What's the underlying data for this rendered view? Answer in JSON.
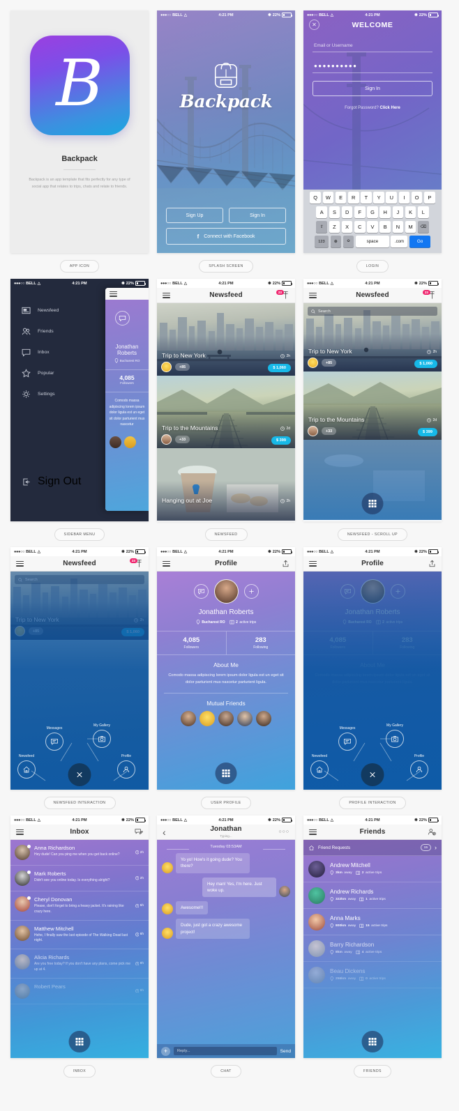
{
  "status_bar": {
    "carrier": "BELL",
    "time": "4:21 PM",
    "battery": "22%",
    "dots": "●●●○○"
  },
  "screens": [
    {
      "caption": "APP ICON"
    },
    {
      "caption": "SPLASH SCREEN"
    },
    {
      "caption": "LOGIN"
    },
    {
      "caption": "SIDEBAR MENU"
    },
    {
      "caption": "NEWSFEED"
    },
    {
      "caption": "NEWSFEED - SCROLL UP"
    },
    {
      "caption": "NEWSFEED INTERACTION"
    },
    {
      "caption": "USER PROFILE"
    },
    {
      "caption": "PROFILE INTERACTION"
    },
    {
      "caption": "INBOX"
    },
    {
      "caption": "CHAT"
    },
    {
      "caption": "FRIENDS"
    }
  ],
  "app_icon": {
    "logo_letter": "Β",
    "name": "Backpack",
    "description": "Backpack is an app template that fits perfectly for any type of social app that relates to trips, chats and relate to friends."
  },
  "splash": {
    "logo_text": "Backpack",
    "sign_up": "Sign Up",
    "sign_in": "Sign In",
    "facebook": "Connect with Facebook",
    "facebook_glyph": "f"
  },
  "login": {
    "title": "WELCOME",
    "close_glyph": "✕",
    "email_placeholder": "Email or Username",
    "password_value": "●●●●●●●●●●",
    "sign_in": "Sign In",
    "forgot_label": "Forgot Password? ",
    "forgot_link": "Click Here",
    "keyboard": {
      "row1": [
        "Q",
        "W",
        "E",
        "R",
        "T",
        "Y",
        "U",
        "I",
        "O",
        "P"
      ],
      "row2": [
        "A",
        "S",
        "D",
        "F",
        "G",
        "H",
        "J",
        "K",
        "L"
      ],
      "row3": [
        "Z",
        "X",
        "C",
        "V",
        "B",
        "N",
        "M"
      ],
      "shift": "⇧",
      "backspace": "⌫",
      "num": "123",
      "globe": "⊕",
      "mic": "⎉",
      "space": "space",
      "dotcom": ".com",
      "go": "Go"
    }
  },
  "sidebar": {
    "items": [
      {
        "label": "Newsfeed",
        "icon": "newsfeed-icon"
      },
      {
        "label": "Friends",
        "icon": "friends-icon"
      },
      {
        "label": "Inbox",
        "icon": "inbox-icon"
      },
      {
        "label": "Popular",
        "icon": "star-icon"
      },
      {
        "label": "Settings",
        "icon": "gear-icon"
      }
    ],
    "sign_out": "Sign Out",
    "peek": {
      "name": "Jonathan Roberts",
      "location": "Bucharest RO",
      "followers_count": "4,085",
      "followers_label": "Followers",
      "about": "Comodo massa adipiscing lorem ipsum dolor ligula est un eget sit dolor parturient mus nascetur"
    }
  },
  "newsfeed": {
    "title": "Newsfeed",
    "badge": "23",
    "search_placeholder": "Search",
    "cards": [
      {
        "title": "Trip to New York",
        "time": "2h",
        "plus": "+85",
        "price": "$ 1,060"
      },
      {
        "title": "Trip to the Mountains",
        "time": "2d",
        "plus": "+33",
        "price": "$ 399"
      },
      {
        "title": "Hanging out at Joe",
        "time": "2h",
        "plus": "",
        "price": ""
      }
    ]
  },
  "radial_menu": {
    "nodes": [
      {
        "label": "Messages",
        "icon": "message-icon"
      },
      {
        "label": "My Gallery",
        "icon": "gallery-icon"
      },
      {
        "label": "Newsfeed",
        "icon": "home-icon"
      },
      {
        "label": "Profile",
        "icon": "person-icon"
      }
    ],
    "close_glyph": "✕"
  },
  "profile": {
    "title": "Profile",
    "name": "Jonathan Roberts",
    "location": "Bucharest RO",
    "trips": "2",
    "trips_label": "active trips",
    "followers": "4,085",
    "followers_label": "Followers",
    "following": "283",
    "following_label": "Following",
    "about_heading": "About Me",
    "about_text": "Comodo massa adipiscing lorem ipsum dolor ligula est un eget sit dolor parturient mus nascetur parturient ligula.",
    "mutual_heading": "Mutual Friends"
  },
  "inbox": {
    "title": "Inbox",
    "messages": [
      {
        "name": "Anna Richardson",
        "time": "2h",
        "text": "Hey dude! Can you ping me when you get back online?"
      },
      {
        "name": "Mark Roberts",
        "time": "2h",
        "text": "Didn't see you online today. Is everything alright?"
      },
      {
        "name": "Cheryl Donovan",
        "time": "5h",
        "text": "Please, don't forget to bring a heavy jacket. It's raining like crazy here."
      },
      {
        "name": "Matthew Mitchell",
        "time": "6h",
        "text": "Hehe, I finally saw the last episode of The Walking Dead last night."
      },
      {
        "name": "Alicia Richards",
        "time": "8h",
        "text": "Are you free today? If you don't have any plans, come pick me up at 4."
      },
      {
        "name": "Robert Pears",
        "time": "9h",
        "text": ""
      }
    ]
  },
  "chat": {
    "title": "Jonathan",
    "subtitle": "Typing...",
    "back_glyph": "‹",
    "more_glyph": "○○○",
    "date": "Tuesday 03:53AM",
    "bubbles": [
      {
        "from": "them",
        "text": "Yo yo! How's it going dude? You there?"
      },
      {
        "from": "me",
        "text": "Hey man! Yes, I'm here. Just woke up."
      },
      {
        "from": "them",
        "text": "Awesome!!!"
      },
      {
        "from": "them",
        "text": "Dude, just got a crazy awesome project!"
      }
    ],
    "reply_placeholder": "Reply...",
    "send_label": "Send",
    "plus_glyph": "+"
  },
  "friends": {
    "title": "Friends",
    "requests_label": "Friend Requests",
    "requests_count": "15",
    "chevron": "›",
    "list": [
      {
        "name": "Andrew Mitchell",
        "distance": "3km",
        "distance_suffix": "away",
        "trips": "2",
        "trips_label": "active trips"
      },
      {
        "name": "Andrew Richards",
        "distance": "322km",
        "distance_suffix": "away",
        "trips": "1",
        "trips_label": "active trips"
      },
      {
        "name": "Anna Marks",
        "distance": "800km",
        "distance_suffix": "away",
        "trips": "15",
        "trips_label": "active trips"
      },
      {
        "name": "Barry Richardson",
        "distance": "8km",
        "distance_suffix": "away",
        "trips": "4",
        "trips_label": "active trips"
      },
      {
        "name": "Beau Dickens",
        "distance": "256km",
        "distance_suffix": "away",
        "trips": "0",
        "trips_label": "active trips"
      }
    ]
  },
  "colors": {
    "accent_blue": "#17b9e8",
    "badge_pink": "#f0256e",
    "sidebar_dark": "#232a3d",
    "keyboard_blue": "#1277f2"
  }
}
